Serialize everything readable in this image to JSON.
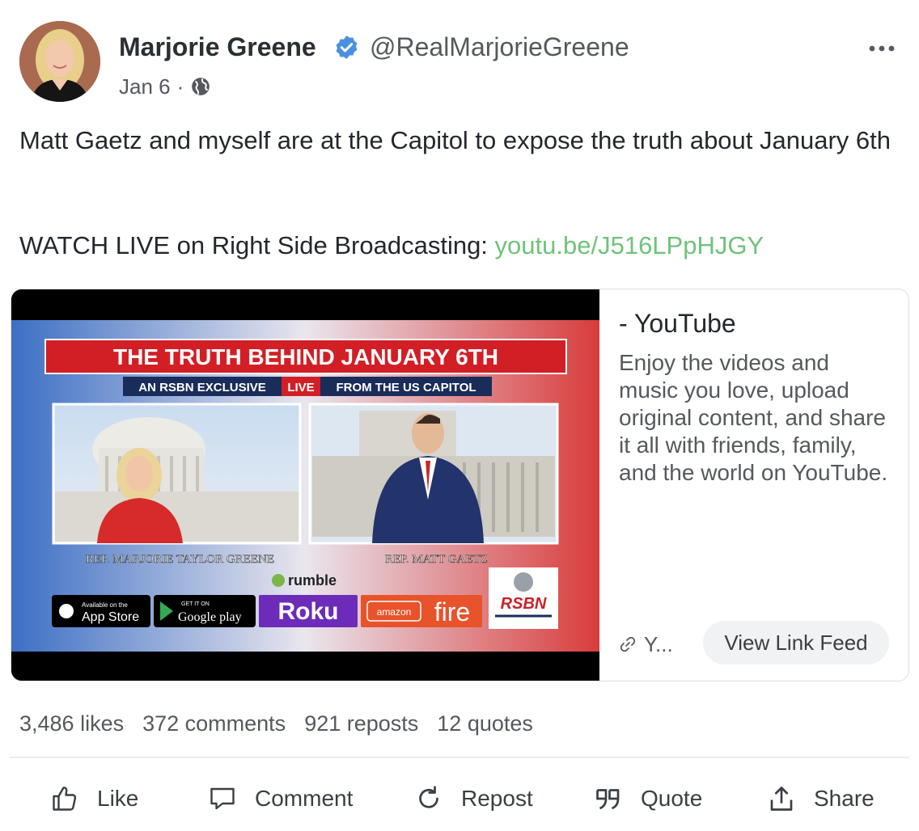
{
  "author": {
    "name": "Marjorie Greene",
    "handle": "@RealMarjorieGreene",
    "date": "Jan 6",
    "separator": "·"
  },
  "post": {
    "text_line1": "Matt Gaetz and myself are at the Capitol to expose the truth about January 6th",
    "text_watch": "WATCH LIVE on Right Side Broadcasting: ",
    "link_text": "youtu.be/J516LPpHJGY"
  },
  "link_card": {
    "thumbnail": {
      "headline": "THE TRUTH BEHIND JANUARY 6TH",
      "sub_left": "AN RSBN EXCLUSIVE",
      "sub_live": "LIVE",
      "sub_right": "FROM THE US CAPITOL",
      "caption_left": "REP. MARJORIE TAYLOR GREENE",
      "caption_right": "REP. MATT GAETZ",
      "rumble": "rumble",
      "appstore_small": "Available on the",
      "appstore": "App Store",
      "googleplay_small": "GET IT ON",
      "googleplay": "Google play",
      "roku": "Roku",
      "amazon": "amazon",
      "fire": "fire",
      "rsbn": "RSBN"
    },
    "source": "- YouTube",
    "description": "Enjoy the videos and music you love, upload original content, and share it all with friends, family, and the world on YouTube.",
    "domain": "Y...",
    "view_feed_label": "View Link Feed"
  },
  "stats": {
    "likes": "3,486 likes",
    "comments": "372 comments",
    "reposts": "921 reposts",
    "quotes": "12 quotes"
  },
  "actions": {
    "like": "Like",
    "comment": "Comment",
    "repost": "Repost",
    "quote": "Quote",
    "share": "Share"
  },
  "colors": {
    "link": "#6fc37a",
    "verified": "#4a90e2",
    "text": "#24282d",
    "muted": "#55595e"
  },
  "icons": [
    "verified-badge-icon",
    "more-icon",
    "globe-icon",
    "link-icon",
    "like-icon",
    "comment-icon",
    "repost-icon",
    "quote-icon",
    "share-icon"
  ]
}
